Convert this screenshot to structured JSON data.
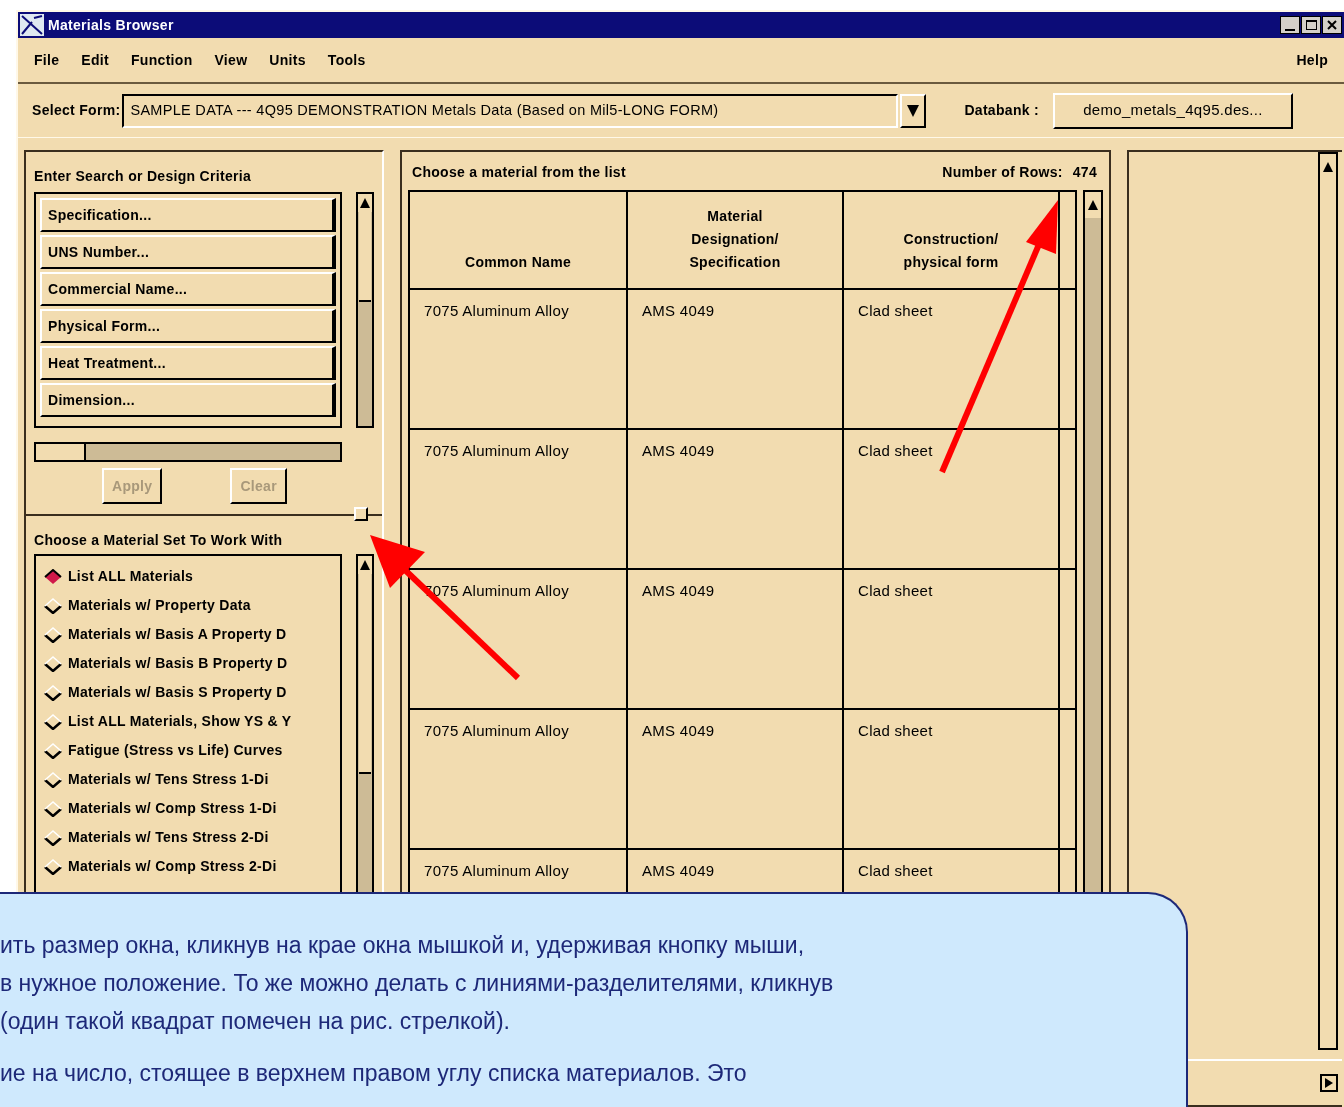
{
  "window": {
    "title": "Materials Browser"
  },
  "menu": [
    "File",
    "Edit",
    "Function",
    "View",
    "Units",
    "Tools"
  ],
  "help_menu": "Help",
  "select_form": {
    "label": "Select Form:",
    "value": "SAMPLE DATA --- 4Q95 DEMONSTRATION Metals Data (Based on Mil5-LONG FORM)"
  },
  "databank": {
    "label": "Databank :",
    "value": "demo_metals_4q95.des..."
  },
  "criteria": {
    "title": "Enter Search or Design Criteria",
    "items": [
      "Specification...",
      "UNS Number...",
      "Commercial Name...",
      "Physical Form...",
      "Heat Treatment...",
      "Dimension..."
    ],
    "buttons": [
      {
        "label": "Apply",
        "disabled": true
      },
      {
        "label": "Clear",
        "disabled": true
      }
    ]
  },
  "material_sets": {
    "title": "Choose a Material Set To Work With",
    "items": [
      {
        "label": "List ALL Materials",
        "selected": true
      },
      {
        "label": "Materials w/ Property Data",
        "selected": false
      },
      {
        "label": "Materials w/ Basis A Property D",
        "selected": false
      },
      {
        "label": "Materials w/ Basis B Property D",
        "selected": false
      },
      {
        "label": "Materials w/ Basis S Property D",
        "selected": false
      },
      {
        "label": "List ALL Materials, Show YS & Y",
        "selected": false
      },
      {
        "label": "Fatigue (Stress vs Life) Curves",
        "selected": false
      },
      {
        "label": "Materials w/ Tens Stress 1-Di",
        "selected": false
      },
      {
        "label": "Materials w/ Comp Stress 1-Di",
        "selected": false
      },
      {
        "label": "Materials w/ Tens Stress 2-Di",
        "selected": false
      },
      {
        "label": "Materials w/ Comp Stress 2-Di",
        "selected": false
      }
    ]
  },
  "table": {
    "title": "Choose a material from the list",
    "rows_label": "Number of Rows:",
    "rows_count": "474",
    "columns": [
      "Common Name",
      "Material\nDesignation/\nSpecification",
      "Construction/\nphysical form"
    ],
    "rows": [
      [
        "7075 Aluminum Alloy",
        "AMS 4049",
        "Clad sheet"
      ],
      [
        "7075 Aluminum Alloy",
        "AMS 4049",
        "Clad sheet"
      ],
      [
        "7075 Aluminum Alloy",
        "AMS 4049",
        "Clad sheet"
      ],
      [
        "7075 Aluminum Alloy",
        "AMS 4049",
        "Clad sheet"
      ],
      [
        "7075 Aluminum Alloy",
        "AMS 4049",
        "Clad sheet"
      ]
    ]
  },
  "callout": {
    "paragraphs": [
      [
        "ить размер окна, кликнув на крае окна мышкой и, удерживая кнопку мыши,",
        "в нужное положение. То же можно делать с линиями-разделителями, кликнув",
        "(один такой квадрат помечен на рис. стрелкой)."
      ],
      [
        "ие на число, стоящее в верхнем правом углу  списка материалов. Это"
      ]
    ]
  }
}
